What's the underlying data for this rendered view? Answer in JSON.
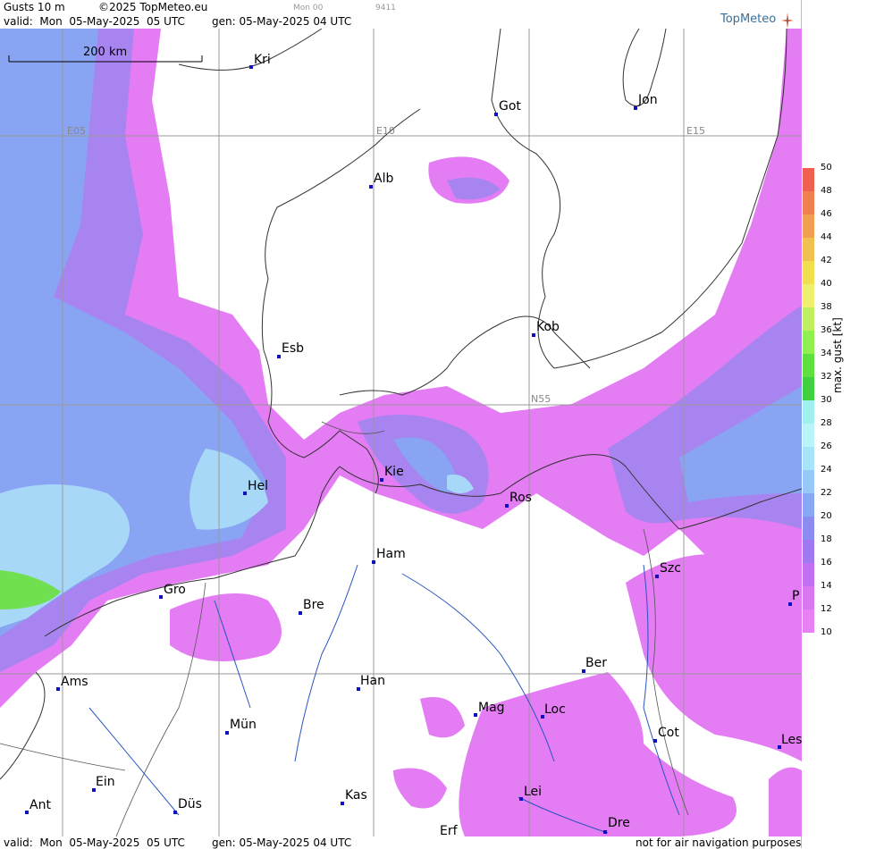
{
  "header": {
    "product": "Gusts 10 m",
    "copyright": "©2025 TopMeteo.eu",
    "valid": "valid:  Mon  05-May-2025  05 UTC",
    "gen": "gen: 05-May-2025 04 UTC",
    "small_run": "Mon 00",
    "small_code": "9411",
    "logo": "TopMeteo"
  },
  "footer": {
    "valid": "valid:  Mon  05-May-2025  05 UTC",
    "gen": "gen: 05-May-2025 04 UTC",
    "note": "not for air navigation purposes"
  },
  "scale": {
    "label": "200 km"
  },
  "grid_labels": {
    "e05": "E05",
    "e10": "E10",
    "e15": "E15",
    "n55": "N55"
  },
  "cities": [
    {
      "name": "Kri"
    },
    {
      "name": "Got"
    },
    {
      "name": "Jon"
    },
    {
      "name": "Alb"
    },
    {
      "name": "Kob"
    },
    {
      "name": "Esb"
    },
    {
      "name": "Kie"
    },
    {
      "name": "Ros"
    },
    {
      "name": "Hel"
    },
    {
      "name": "Ham"
    },
    {
      "name": "Szc"
    },
    {
      "name": "Gro"
    },
    {
      "name": "Bre"
    },
    {
      "name": "P"
    },
    {
      "name": "Ber"
    },
    {
      "name": "Ams"
    },
    {
      "name": "Han"
    },
    {
      "name": "Mag"
    },
    {
      "name": "Loc"
    },
    {
      "name": "Mün"
    },
    {
      "name": "Cot"
    },
    {
      "name": "Les"
    },
    {
      "name": "Ein"
    },
    {
      "name": "Kas"
    },
    {
      "name": "Lei"
    },
    {
      "name": "Ant"
    },
    {
      "name": "Düs"
    },
    {
      "name": "Dre"
    },
    {
      "name": "Erf"
    }
  ],
  "legend": {
    "title": "max. gust [kt]",
    "ticks": [
      "50",
      "48",
      "46",
      "44",
      "42",
      "40",
      "38",
      "36",
      "34",
      "32",
      "30",
      "28",
      "26",
      "24",
      "22",
      "20",
      "18",
      "16",
      "14",
      "12",
      "10"
    ],
    "colors": [
      "#f06050",
      "#f08050",
      "#f0a050",
      "#f0c050",
      "#f0e050",
      "#f0f070",
      "#c0f060",
      "#90f050",
      "#60e040",
      "#40d040",
      "#a0f0f0",
      "#b8f4f8",
      "#a8e4f8",
      "#98c8f8",
      "#88a8f4",
      "#8c8cf0",
      "#a078f0",
      "#c070f0",
      "#d878f0",
      "#e880f4"
    ]
  },
  "colors": {
    "low_gust": "#e47cf4",
    "mid_gust": "#a884f0",
    "blue_gust": "#8aa4f4",
    "light_blue": "#a8d8f8",
    "green": "#70e050"
  }
}
